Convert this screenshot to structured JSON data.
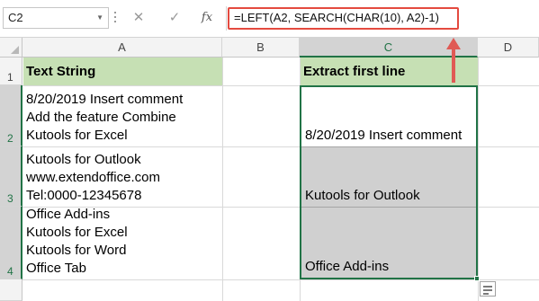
{
  "formula_bar": {
    "name_box": "C2",
    "cancel_glyph": "✕",
    "enter_glyph": "✓",
    "fx_label": "fx",
    "formula": "=LEFT(A2, SEARCH(CHAR(10), A2)-1)"
  },
  "columns": [
    "A",
    "B",
    "C",
    "D"
  ],
  "rows": [
    "1",
    "2",
    "3",
    "4"
  ],
  "sheet": {
    "a1": "Text String",
    "c1": "Extract first line",
    "a2": [
      "8/20/2019 Insert comment",
      "Add the feature Combine",
      "Kutools for Excel"
    ],
    "a3": [
      "Kutools for Outlook",
      "www.extendoffice.com",
      "Tel:0000-12345678"
    ],
    "a4": [
      "Office Add-ins",
      "Kutools for Excel",
      "Kutools for Word",
      "Office Tab"
    ],
    "c2": "8/20/2019 Insert comment",
    "c3": "Kutools for Outlook",
    "c4": "Office Add-ins"
  },
  "colors": {
    "header_fill": "#c6e0b4",
    "selection": "#217346",
    "highlight": "#e44a3f",
    "result_gray": "#d0d0d0"
  },
  "icons": [
    "cancel-icon",
    "enter-icon",
    "fx-icon",
    "quick-analysis-icon",
    "arrow-up-annotation"
  ]
}
